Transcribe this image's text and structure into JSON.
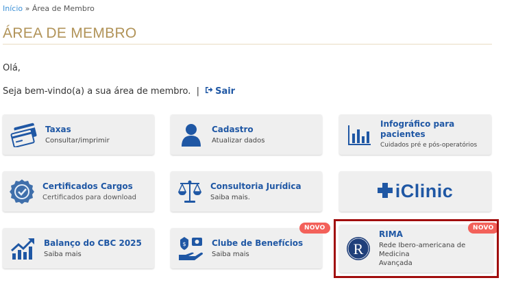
{
  "breadcrumb": {
    "home": "Início",
    "separator": "»",
    "current": "Área de Membro"
  },
  "page_title": "ÁREA DE MEMBRO",
  "greeting": "Olá,",
  "welcome": {
    "text": "Seja bem-vindo(a) a sua área de membro.",
    "divider": "|",
    "logout_label": "Sair"
  },
  "cards": {
    "taxas": {
      "title": "Taxas",
      "subtitle": "Consultar/imprimir"
    },
    "cadastro": {
      "title": "Cadastro",
      "subtitle": "Atualizar dados"
    },
    "infografico": {
      "title": "Infográfico para pacientes",
      "subtitle": "Cuidados pré e pós-operatórios"
    },
    "certificados": {
      "title": "Certificados Cargos",
      "subtitle": "Certificados para download"
    },
    "consultoria": {
      "title": "Consultoria Jurídica",
      "subtitle": "Saiba mais."
    },
    "iclinic": {
      "label": "iClinic"
    },
    "balanco": {
      "title": "Balanço do CBC 2025",
      "subtitle": "Saiba mais"
    },
    "clube": {
      "title": "Clube de Benefícios",
      "subtitle": "Saiba mais",
      "badge": "NOVO"
    },
    "rima": {
      "title": "RIMA",
      "subtitle_line1": "Rede Ibero-americana de Medicina",
      "subtitle_line2": "Avançada",
      "badge": "NOVO",
      "logo_letter": "R"
    }
  },
  "colors": {
    "accent_gold": "#b19358",
    "link_blue": "#1f57a4",
    "badge_red": "#f3615a",
    "highlight_red": "#a10c0c",
    "card_bg": "#efefef"
  }
}
